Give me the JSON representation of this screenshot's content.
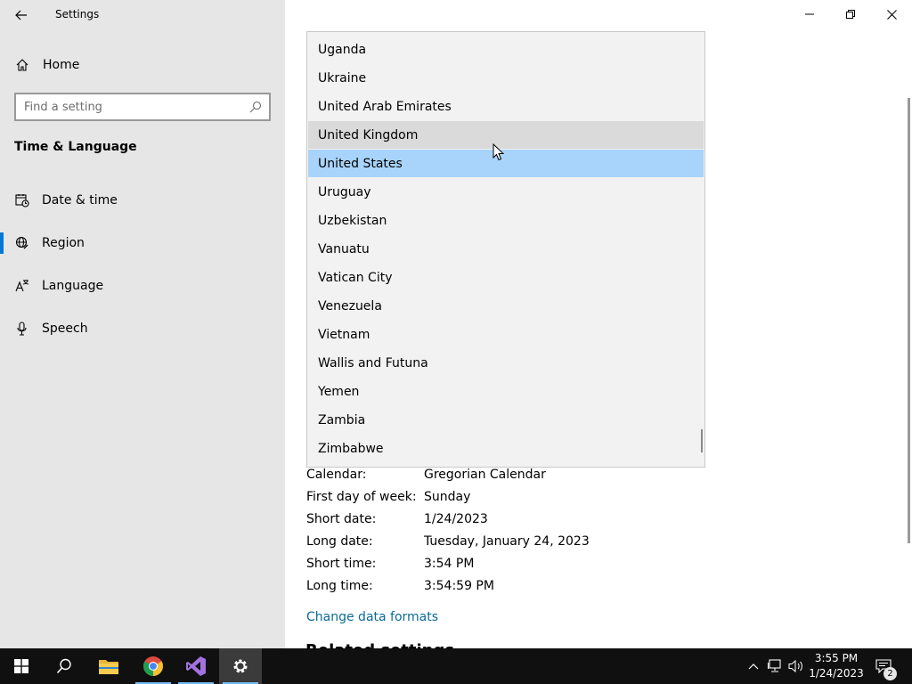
{
  "window": {
    "title": "Settings"
  },
  "sidebar": {
    "home_label": "Home",
    "search_placeholder": "Find a setting",
    "section_title": "Time & Language",
    "items": [
      {
        "label": "Date & time",
        "icon": "calendar-clock-icon"
      },
      {
        "label": "Region",
        "icon": "globe-icon",
        "active": true
      },
      {
        "label": "Language",
        "icon": "language-icon"
      },
      {
        "label": "Speech",
        "icon": "microphone-icon"
      }
    ]
  },
  "country_list": {
    "items": [
      "Uganda",
      "Ukraine",
      "United Arab Emirates",
      "United Kingdom",
      "United States",
      "Uruguay",
      "Uzbekistan",
      "Vanuatu",
      "Vatican City",
      "Venezuela",
      "Vietnam",
      "Wallis and Futuna",
      "Yemen",
      "Zambia",
      "Zimbabwe"
    ],
    "hovered": "United Kingdom",
    "selected": "United States"
  },
  "formats": {
    "rows": [
      {
        "key": "Calendar:",
        "value": "Gregorian Calendar"
      },
      {
        "key": "First day of week:",
        "value": "Sunday"
      },
      {
        "key": "Short date:",
        "value": "1/24/2023"
      },
      {
        "key": "Long date:",
        "value": "Tuesday, January 24, 2023"
      },
      {
        "key": "Short time:",
        "value": "3:54 PM"
      },
      {
        "key": "Long time:",
        "value": "3:54:59 PM"
      }
    ],
    "change_link": "Change data formats"
  },
  "related_settings_heading": "Related settings",
  "taskbar": {
    "time": "3:55 PM",
    "date": "1/24/2023",
    "notification_count": "2"
  },
  "colors": {
    "accent": "#0078d7",
    "selection": "#a8d4fb",
    "hover": "#dadada",
    "link": "#0a6b96",
    "taskbar": "#101010"
  }
}
